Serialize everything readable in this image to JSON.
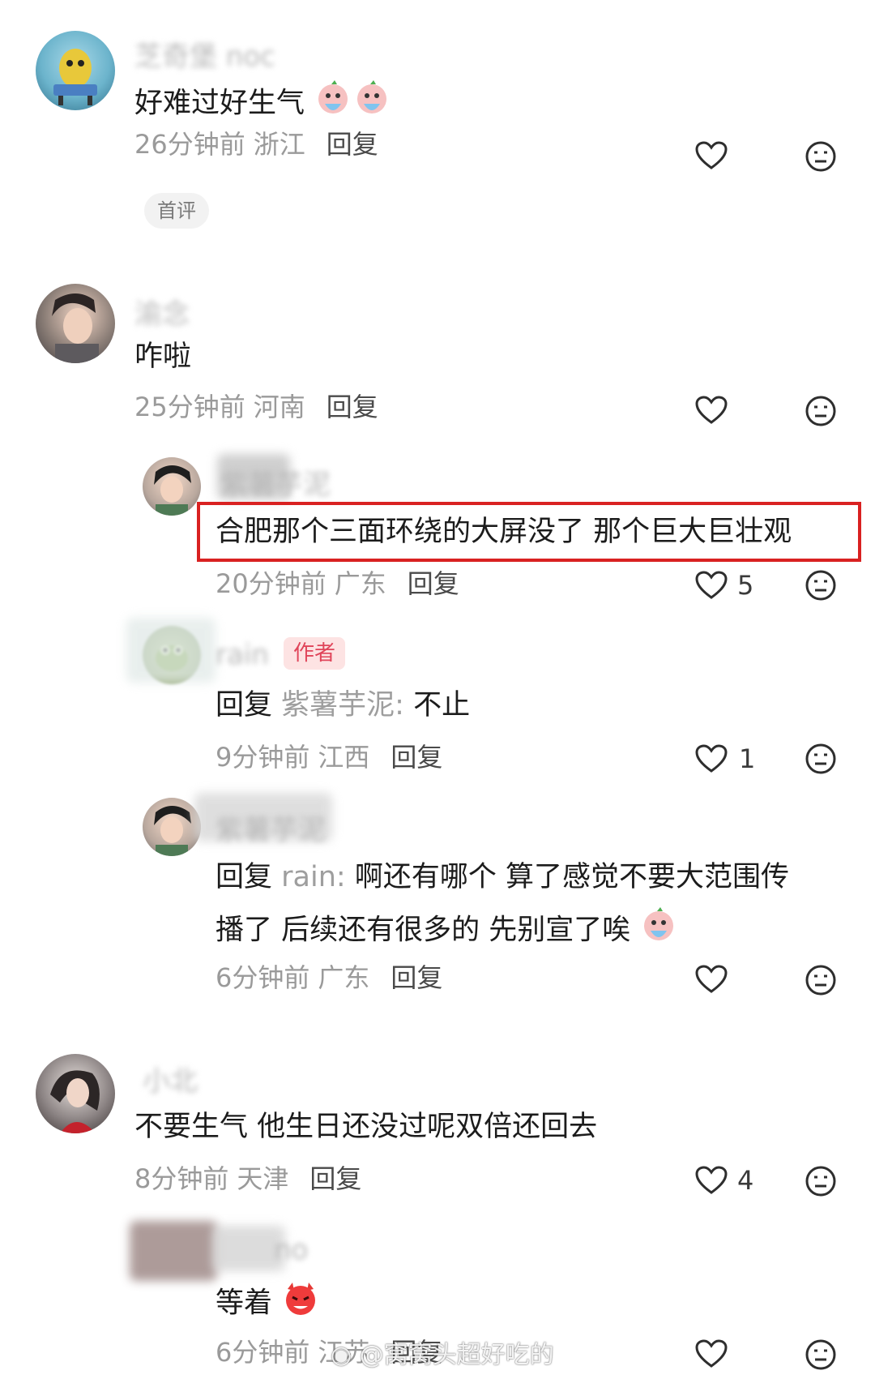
{
  "comments": [
    {
      "username": "芝奇堡 noc",
      "text": "好难过好生气",
      "time": "26分钟前",
      "location": "浙江",
      "reply": "回复",
      "tag": "首评"
    },
    {
      "username": "渝念",
      "text": "咋啦",
      "time": "25分钟前",
      "location": "河南",
      "reply": "回复",
      "replies": [
        {
          "username": "紫薯芋泥",
          "text": "合肥那个三面环绕的大屏没了 那个巨大巨壮观",
          "time": "20分钟前",
          "location": "广东",
          "reply": "回复",
          "likes": "5"
        },
        {
          "username": "rain",
          "badge": "作者",
          "reply_prefix": "回复",
          "reply_to": "紫薯芋泥:",
          "text": "不止",
          "time": "9分钟前",
          "location": "江西",
          "reply": "回复",
          "likes": "1"
        },
        {
          "username": "紫薯芋泥",
          "reply_prefix": "回复",
          "reply_to": "rain:",
          "text_line1": "啊还有哪个 算了感觉不要大范围传",
          "text_line2": "播了 后续还有很多的 先别宣了唉",
          "time": "6分钟前",
          "location": "广东",
          "reply": "回复"
        }
      ]
    },
    {
      "username": "小北",
      "text": "不要生气 他生日还没过呢双倍还回去",
      "time": "8分钟前",
      "location": "天津",
      "reply": "回复",
      "likes": "4",
      "replies": [
        {
          "username": "no",
          "text": "等着",
          "time": "6分钟前",
          "location": "江苏",
          "reply": "回复"
        }
      ]
    }
  ],
  "watermark": "@窝窝头超好吃的",
  "colors": {
    "highlight_box": "#d92121",
    "meta_gray": "#9a9a9a",
    "text_dark": "#1c1c1c"
  }
}
